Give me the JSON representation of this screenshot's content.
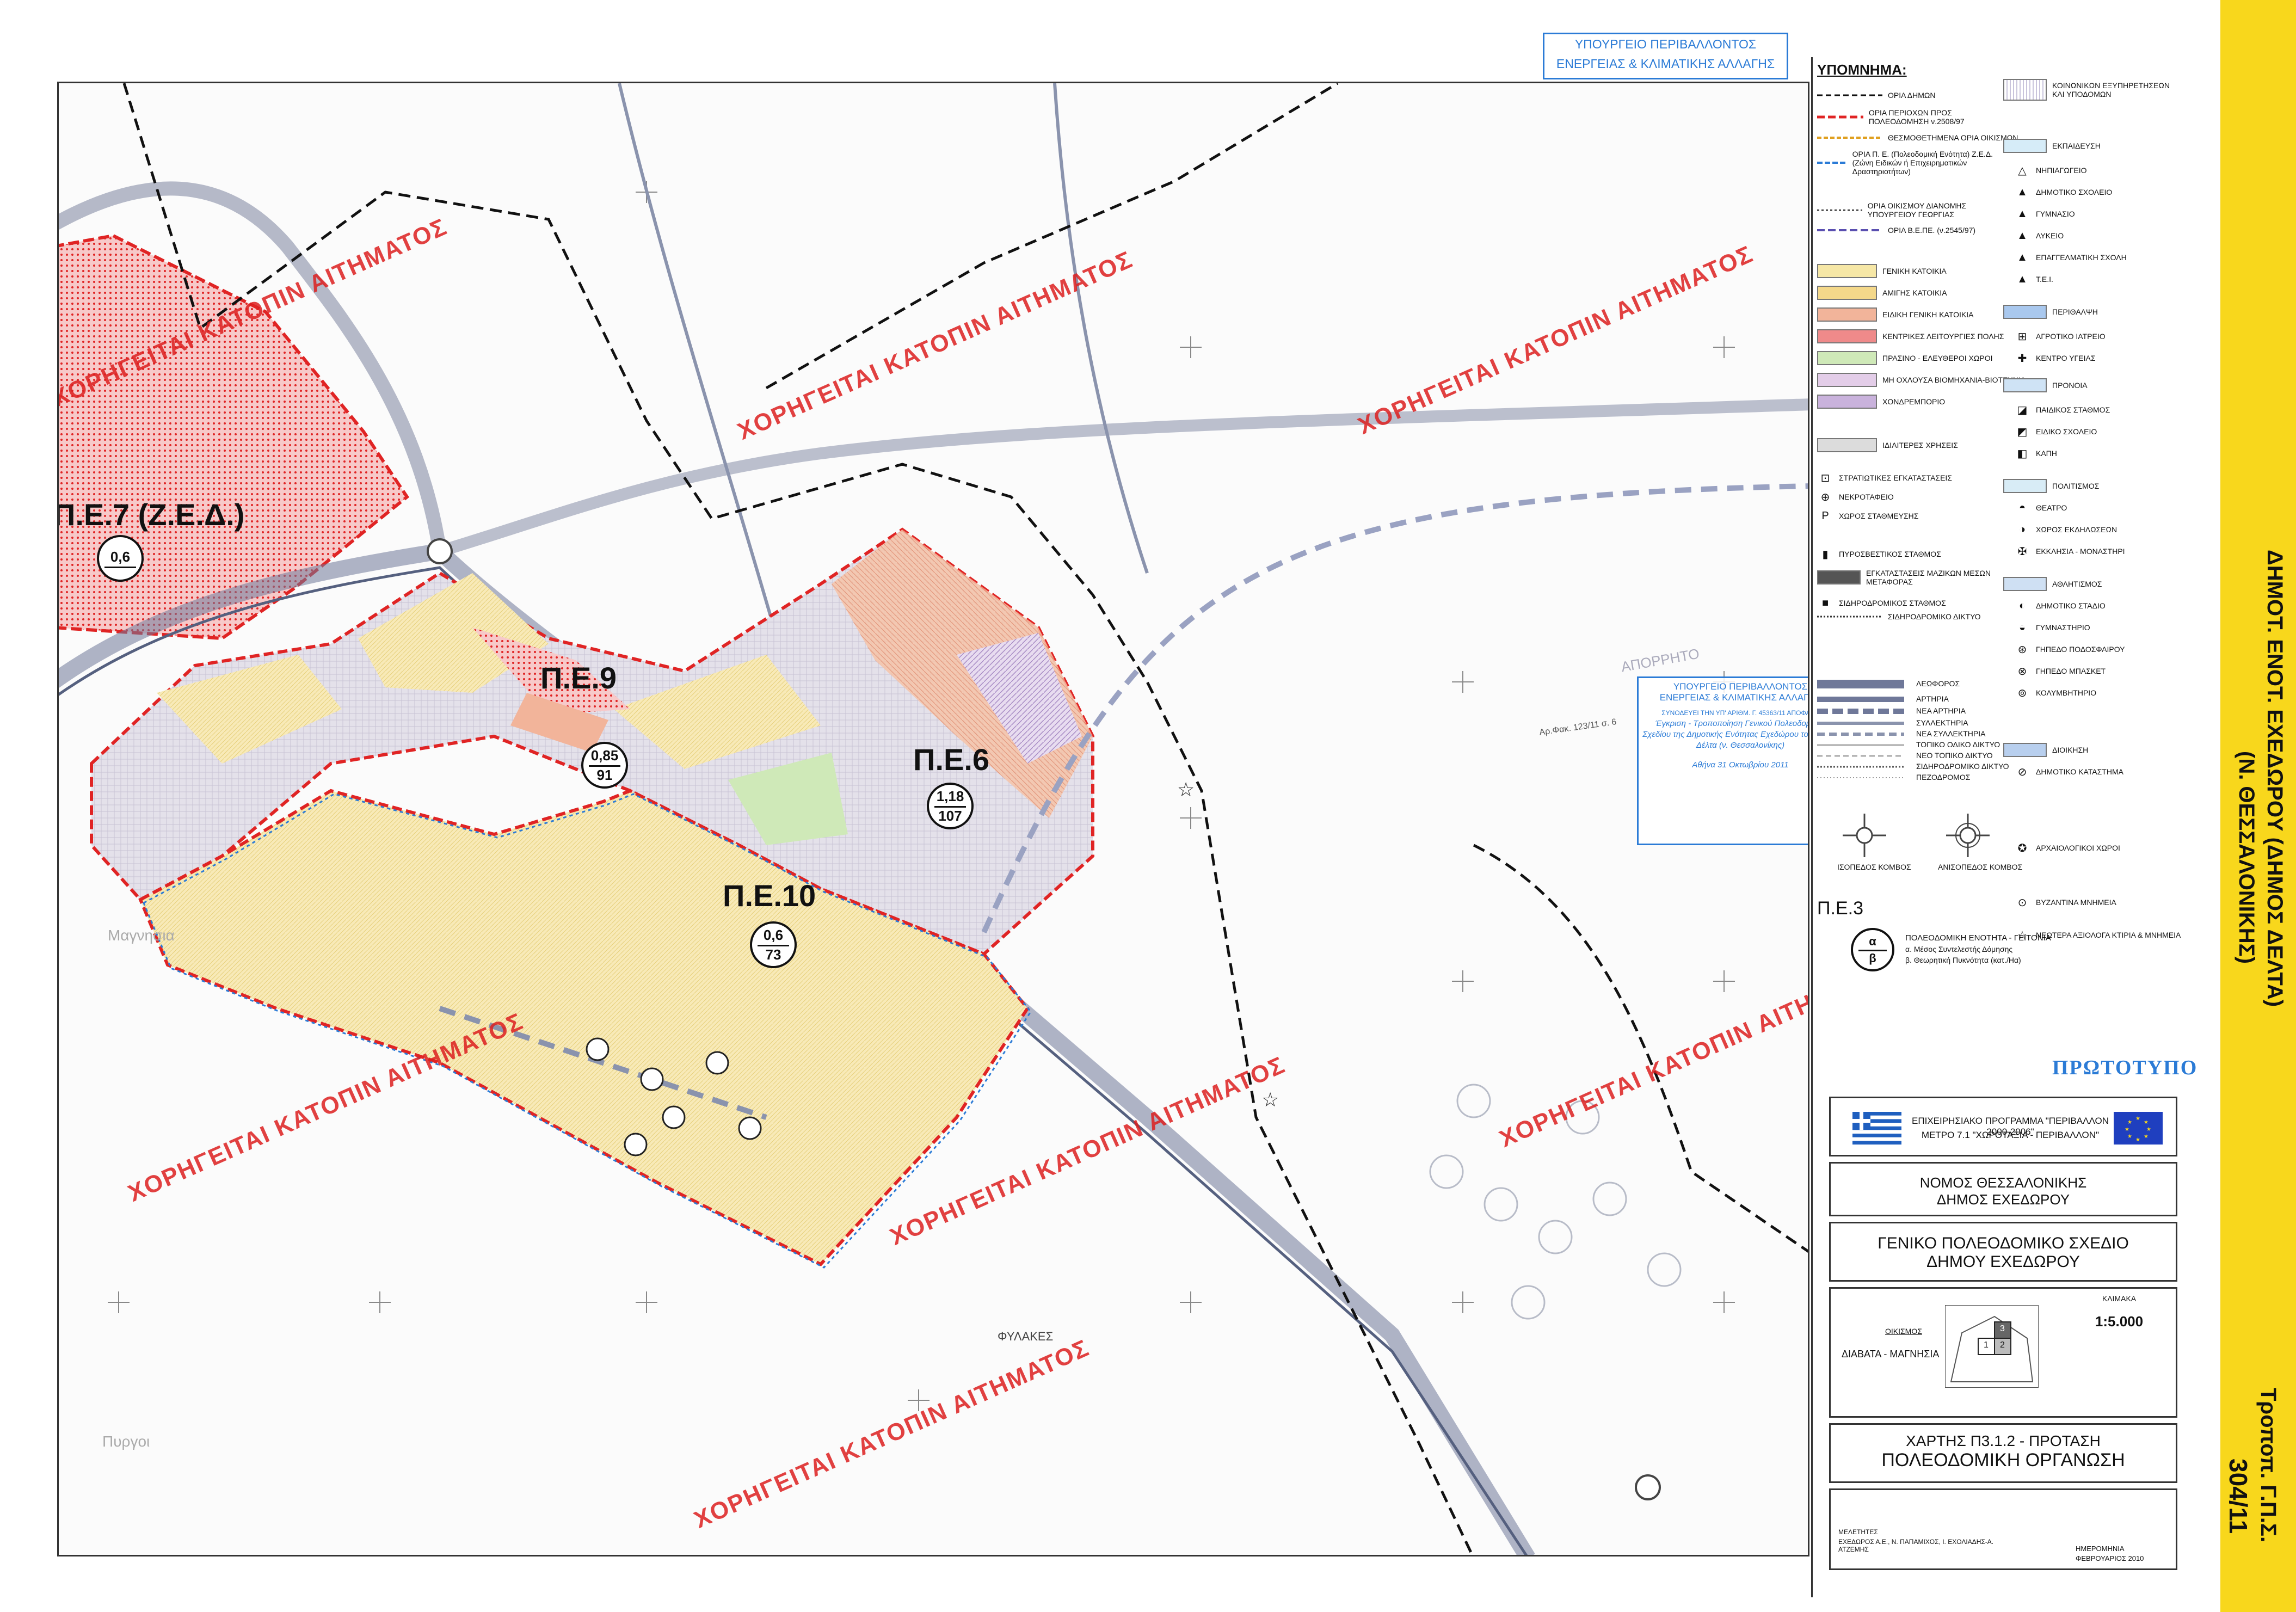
{
  "ministry_stamp_top": {
    "line1": "ΥΠΟΥΡΓΕΙΟ ΠΕΡΙΒΑΛΛΟΝΤΟΣ",
    "line2": "ΕΝΕΡΓΕΙΑΣ & ΚΛΙΜΑΤΙΚΗΣ ΑΛΛΑΓΗΣ"
  },
  "watermark_text": "ΧΟΡΗΓΕΙΤΑΙ ΚΑΤΟΠΙΝ ΑΙΤΗΜΑΤΟΣ",
  "zones": [
    {
      "name": "Π.Ε.7 (Ζ.Ε.Δ.)",
      "ratio_top": "0,6",
      "ratio_bottom": ""
    },
    {
      "name": "Π.Ε.9",
      "ratio_top": "0,85",
      "ratio_bottom": "91"
    },
    {
      "name": "Π.Ε.6",
      "ratio_top": "1,18",
      "ratio_bottom": "107"
    },
    {
      "name": "Π.Ε.10",
      "ratio_top": "0,6",
      "ratio_bottom": "73"
    }
  ],
  "places": {
    "aporrito": "ΑΠΟΡΡΗΤΟ",
    "fylakes": "ΦΥΛΑΚΕΣ",
    "pyrgos": "Πυργοι",
    "magnisia": "Μαγνησια"
  },
  "decision_stamp": {
    "line1": "ΥΠΟΥΡΓΕΙΟ ΠΕΡΙΒΑΛΛΟΝΤΟΣ",
    "line2": "ΕΝΕΡΓΕΙΑΣ & ΚΛΙΜΑΤΙΚΗΣ ΑΛΛΑΓΗΣ",
    "line3": "ΣΥΝΟΔΕΥΕΙ ΤΗΝ ΥΠ' ΑΡΙΘΜ. Γ. 45363/11 ΑΠΟΦΑΣΗ",
    "line4": "Έγκριση - Τροποποίηση Γενικού Πολεοδομικού Σχεδίου της Δημοτικής Ενότητας Εχεδώρου του Δήμου Δέλτα (ν. Θεσσαλονίκης)",
    "line5": "Αθήνα 31 Οκτωβρίου 2011",
    "side_note": "Αρ.Φακ. 123/11 σ. 6"
  },
  "legend": {
    "title": "ΥΠΟΜΝΗΜΑ:",
    "boundaries": [
      "ΟΡΙΑ ΔΗΜΩΝ",
      "ΟΡΙΑ ΠΕΡΙΟΧΩΝ ΠΡΟΣ ΠΟΛΕΟΔΟΜΗΣΗ ν.2508/97",
      "ΘΕΣΜΟΘΕΤΗΜΕΝΑ ΟΡΙΑ ΟΙΚΙΣΜΩΝ",
      "ΟΡΙΑ Π. Ε. (Πολεοδομική Ενότητα) Ζ.Ε.Δ. (Ζώνη Ειδικών ή Επιχειρηματικών Δραστηριοτήτων)",
      "ΟΡΙΑ ΟΙΚΙΣΜΟΥ ΔΙΑΝΟΜΗΣ ΥΠΟΥΡΓΕΙΟΥ ΓΕΩΡΓΙΑΣ",
      "ΟΡΙΑ Β.Ε.ΠΕ. (ν.2545/97)"
    ],
    "land_uses": [
      {
        "label": "ΓΕΝΙΚΗ ΚΑΤΟΙΚΙΑ",
        "color": "#f6e7a6"
      },
      {
        "label": "ΑΜΙΓΗΣ ΚΑΤΟΙΚΙΑ",
        "color": "#f4d88a"
      },
      {
        "label": "ΕΙΔΙΚΗ ΓΕΝΙΚΗ ΚΑΤΟΙΚΙΑ",
        "color": "#f2b49a"
      },
      {
        "label": "ΚΕΝΤΡΙΚΕΣ ΛΕΙΤΟΥΡΓΙΕΣ ΠΟΛΗΣ",
        "color": "#ef8a8a"
      },
      {
        "label": "ΠΡΑΣΙΝΟ - ΕΛΕΥΘΕΡΟΙ ΧΩΡΟΙ",
        "color": "#cfe9b8"
      },
      {
        "label": "ΜΗ ΟΧΛΟΥΣΑ ΒΙΟΜΗΧΑΝΙΑ-ΒΙΟΤΕΧΝΙΑ",
        "color": "#e3cde8"
      },
      {
        "label": "ΧΟΝΔΡΕΜΠΟΡΙΟ",
        "color": "#c9b2dc"
      },
      {
        "label": "ΙΔΙΑΙΤΕΡΕΣ ΧΡΗΣΕΙΣ",
        "color": "#dcdcdc"
      }
    ],
    "special_symbols": [
      "ΣΤΡΑΤΙΩΤΙΚΕΣ ΕΓΚΑΤΑΣΤΑΣΕΙΣ",
      "ΝΕΚΡΟΤΑΦΕΙΟ",
      "ΧΩΡΟΣ ΣΤΑΘΜΕΥΣΗΣ"
    ],
    "transport": [
      "ΠΥΡΟΣΒΕΣΤΙΚΟΣ ΣΤΑΘΜΟΣ",
      "ΕΓΚΑΤΑΣΤΑΣΕΙΣ ΜΑΖΙΚΩΝ ΜΕΣΩΝ ΜΕΤΑΦΟΡΑΣ",
      "ΣΙΔΗΡΟΔΡΟΜΙΚΟΣ ΣΤΑΘΜΟΣ",
      "ΣΙΔΗΡΟΔΡΟΜΙΚΟ ΔΙΚΤΥΟ"
    ],
    "roads": [
      "ΛΕΩΦΟΡΟΣ",
      "ΑΡΤΗΡΙΑ",
      "ΝΕΑ ΑΡΤΗΡΙΑ",
      "ΣΥΛΛΕΚΤΗΡΙΑ",
      "ΝΕΑ ΣΥΛΛΕΚΤΗΡΙΑ",
      "ΤΟΠΙΚΟ ΟΔΙΚΟ ΔΙΚΤΥΟ",
      "ΝΕΟ ΤΟΠΙΚΟ ΔΙΚΤΥΟ",
      "ΣΙΔΗΡΟΔΡΟΜΙΚΟ ΔΙΚΤΥΟ",
      "ΠΕΖΟΔΡΟΜΟΣ"
    ],
    "nodes": [
      "ΙΣΟΠΕΔΟΣ ΚΟΜΒΟΣ",
      "ΑΝΙΣΟΠΕΔΟΣ ΚΟΜΒΟΣ"
    ],
    "pe_example": {
      "label": "Π.Ε.3",
      "desc": "ΠΟΛΕΟΔΟΜΙΚΗ ΕΝΟΤΗΤΑ - ΓΕΙΤΟΝΙΑ",
      "a": "α. Μέσος Συντελεστής Δόμησης",
      "b": "β. Θεωρητική Πυκνότητα (κατ./Ηα)"
    },
    "facilities": [
      "ΚΟΙΝΩΝΙΚΩΝ ΕΞΥΠΗΡΕΤΗΣΕΩΝ ΚΑΙ ΥΠΟΔΟΜΩΝ",
      "ΕΚΠΑΙΔΕΥΣΗ",
      "ΝΗΠΙΑΓΩΓΕΙΟ",
      "ΔΗΜΟΤΙΚΟ ΣΧΟΛΕΙΟ",
      "ΓΥΜΝΑΣΙΟ",
      "ΛΥΚΕΙΟ",
      "ΕΠΑΓΓΕΛΜΑΤΙΚΗ ΣΧΟΛΗ",
      "Τ.Ε.Ι.",
      "ΠΕΡΙΘΑΛΨΗ",
      "ΑΓΡΟΤΙΚΟ ΙΑΤΡΕΙΟ",
      "ΚΕΝΤΡΟ ΥΓΕΙΑΣ",
      "ΠΡΟΝΟΙΑ",
      "ΠΑΙΔΙΚΟΣ ΣΤΑΘΜΟΣ",
      "ΕΙΔΙΚΟ ΣΧΟΛΕΙΟ",
      "ΚΑΠΗ",
      "ΠΟΛΙΤΙΣΜΟΣ",
      "ΘΕΑΤΡΟ",
      "ΧΩΡΟΣ ΕΚΔΗΛΩΣΕΩΝ",
      "ΕΚΚΛΗΣΙΑ - ΜΟΝΑΣΤΗΡΙ",
      "ΑΘΛΗΤΙΣΜΟΣ",
      "ΔΗΜΟΤΙΚΟ ΣΤΑΔΙΟ",
      "ΓΥΜΝΑΣΤΗΡΙΟ",
      "ΓΗΠΕΔΟ ΠΟΔΟΣΦΑΙΡΟΥ",
      "ΓΗΠΕΔΟ ΜΠΑΣΚΕΤ",
      "ΚΟΛΥΜΒΗΤΗΡΙΟ",
      "ΔΙΟΙΚΗΣΗ",
      "ΔΗΜΟΤΙΚΟ ΚΑΤΑΣΤΗΜΑ"
    ],
    "heritage": [
      "ΑΡΧΑΙΟΛΟΓΙΚΟΙ ΧΩΡΟΙ",
      "ΒΥΖΑΝΤΙΝΑ ΜΝΗΜΕΙΑ",
      "ΝΕΩΤΕΡΑ ΑΞΙΟΛΟΓΑ ΚΤΙΡΙΑ & ΜΝΗΜΕΙΑ"
    ]
  },
  "prototype_stamp": "ΠΡΩΤΟΤΥΠΟ",
  "program": {
    "line1": "ΕΠΙΧΕΙΡΗΣΙΑΚΟ ΠΡΟΓΡΑΜΜΑ \"ΠΕΡΙΒΑΛΛΟΝ 2000-2006\"",
    "line2": "ΜΕΤΡΟ 7.1 \"ΧΩΡΟΤΑΞΙΑ - ΠΕΡΙΒΑΛΛΟΝ\""
  },
  "authority": {
    "line1": "ΝΟΜΟΣ ΘΕΣΣΑΛΟΝΙΚΗΣ",
    "line2": "ΔΗΜΟΣ ΕΧΕΔΩΡΟΥ"
  },
  "plan_title": {
    "line1": "ΓΕΝΙΚΟ ΠΟΛΕΟΔΟΜΙΚΟ ΣΧΕΔΙΟ",
    "line2": "ΔΗΜΟΥ ΕΧΕΔΩΡΟΥ"
  },
  "scale": {
    "label": "ΚΛΙΜΑΚΑ",
    "value": "1:5.000",
    "settlement_label": "ΟΙΚΙΣΜΟΣ",
    "settlement": "ΔΙΑΒΑΤΑ - ΜΑΓΝΗΣΙΑ",
    "index": [
      "1",
      "2",
      "3"
    ]
  },
  "map_sheet": {
    "line1": "ΧΑΡΤΗΣ  Π3.1.2  -  ΠΡΟΤΑΣΗ",
    "line2": "ΠΟΛΕΟΔΟΜΙΚΗ ΟΡΓΑΝΩΣΗ"
  },
  "credits": {
    "label": "ΜΕΛΕΤΗΤΕΣ",
    "text": "ΕΧΕΔΩΡΟΣ Α.Ε., Ν. ΠΑΠΑΜΙΧΟΣ, Ι. ΕΧΟΛΙΑΔΗΣ-Α. ΑΤΖΕΜΗΣ",
    "date_label": "ΗΜΕΡΟΜΗΝΙΑ",
    "date": "ΦΕΒΡΟΥΑΡΙΟΣ 2010"
  },
  "tab": {
    "line1": "ΔΗΜΟΤ. ΕΝΟΤ. ΕΧΕΔΩΡΟΥ (ΔΗΜΟΣ ΔΕΛΤΑ)",
    "line2": "(Ν. ΘΕΣΣΑΛΟΝΙΚΗΣ)",
    "line3": "Τροποπ. Γ.Π.Σ.",
    "line4": "304/11"
  },
  "colors": {
    "red": "#e02424",
    "blue": "#2b7bd6",
    "yellow_tab": "#f8d71c"
  }
}
